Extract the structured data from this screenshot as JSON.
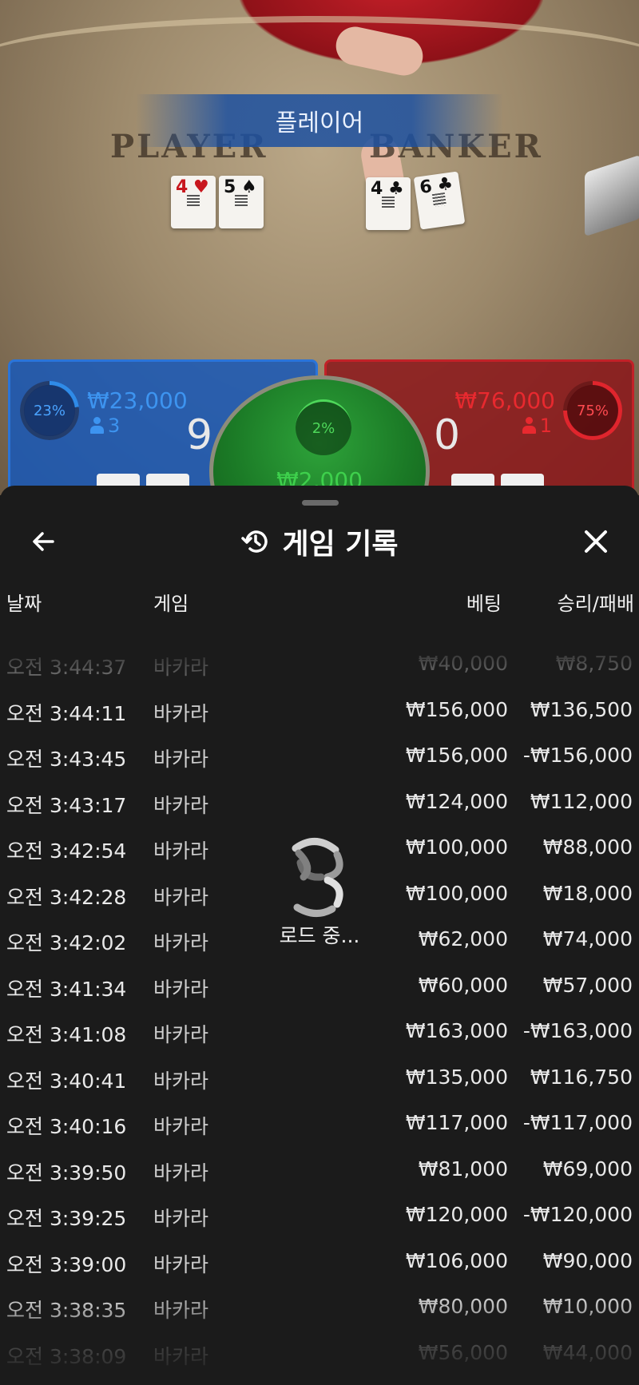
{
  "game_view": {
    "banner": "플레이어",
    "table_player_word": "PLAYER",
    "table_banker_word": "BANKER",
    "player_cards": [
      {
        "rank": "4",
        "suit": "♥",
        "color": "red"
      },
      {
        "rank": "5",
        "suit": "♠",
        "color": "black"
      }
    ],
    "banker_cards": [
      {
        "rank": "4",
        "suit": "♣",
        "color": "black"
      },
      {
        "rank": "6",
        "suit": "♣",
        "color": "black"
      }
    ]
  },
  "bets": {
    "player": {
      "percent": "23%",
      "percent_value": 0.23,
      "pot": "₩23,000",
      "players": "3",
      "score": "9",
      "color": "#2a74d9"
    },
    "tie": {
      "percent": "2%",
      "percent_value": 0.02,
      "pot": "₩2,000",
      "color": "#2ea33a"
    },
    "banker": {
      "percent": "75%",
      "percent_value": 0.75,
      "pot": "₩76,000",
      "players": "1",
      "score": "0",
      "color": "#c22128"
    }
  },
  "sheet": {
    "title": "게임 기록",
    "back_icon": "arrow-left-icon",
    "history_icon": "history-icon",
    "close_icon": "close-icon",
    "columns": {
      "date": "날짜",
      "game": "게임",
      "bet": "베팅",
      "result": "승리/패배"
    },
    "loading_text": "로드 중...",
    "rows": [
      {
        "time": "오전 3:44:37",
        "game": "바카라",
        "bet": "₩40,000",
        "result": "₩8,750"
      },
      {
        "time": "오전 3:44:11",
        "game": "바카라",
        "bet": "₩156,000",
        "result": "₩136,500"
      },
      {
        "time": "오전 3:43:45",
        "game": "바카라",
        "bet": "₩156,000",
        "result": "-₩156,000"
      },
      {
        "time": "오전 3:43:17",
        "game": "바카라",
        "bet": "₩124,000",
        "result": "₩112,000"
      },
      {
        "time": "오전 3:42:54",
        "game": "바카라",
        "bet": "₩100,000",
        "result": "₩88,000"
      },
      {
        "time": "오전 3:42:28",
        "game": "바카라",
        "bet": "₩100,000",
        "result": "₩18,000"
      },
      {
        "time": "오전 3:42:02",
        "game": "바카라",
        "bet": "₩62,000",
        "result": "₩74,000"
      },
      {
        "time": "오전 3:41:34",
        "game": "바카라",
        "bet": "₩60,000",
        "result": "₩57,000"
      },
      {
        "time": "오전 3:41:08",
        "game": "바카라",
        "bet": "₩163,000",
        "result": "-₩163,000"
      },
      {
        "time": "오전 3:40:41",
        "game": "바카라",
        "bet": "₩135,000",
        "result": "₩116,750"
      },
      {
        "time": "오전 3:40:16",
        "game": "바카라",
        "bet": "₩117,000",
        "result": "-₩117,000"
      },
      {
        "time": "오전 3:39:50",
        "game": "바카라",
        "bet": "₩81,000",
        "result": "₩69,000"
      },
      {
        "time": "오전 3:39:25",
        "game": "바카라",
        "bet": "₩120,000",
        "result": "-₩120,000"
      },
      {
        "time": "오전 3:39:00",
        "game": "바카라",
        "bet": "₩106,000",
        "result": "₩90,000"
      },
      {
        "time": "오전 3:38:35",
        "game": "바카라",
        "bet": "₩80,000",
        "result": "₩10,000"
      },
      {
        "time": "오전 3:38:09",
        "game": "바카라",
        "bet": "₩56,000",
        "result": "₩44,000"
      }
    ]
  }
}
